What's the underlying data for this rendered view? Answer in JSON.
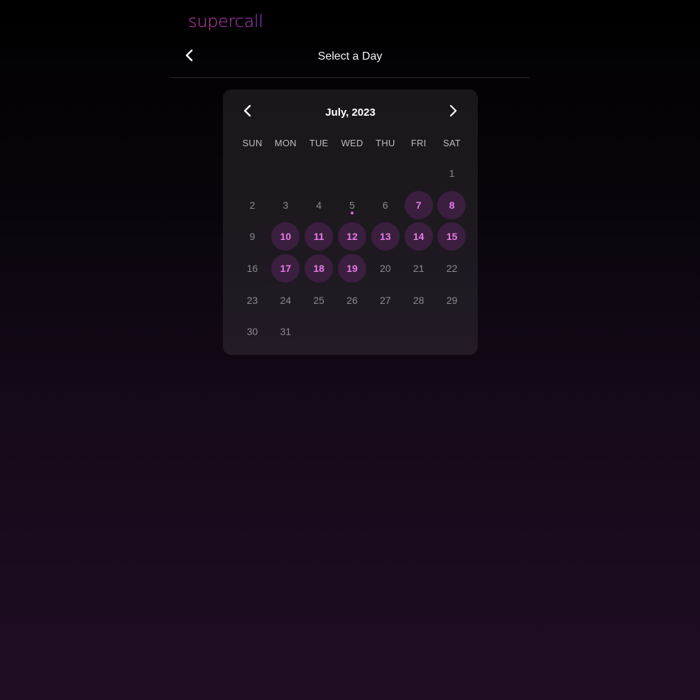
{
  "brand": {
    "logo_text": "supercall",
    "accent": "#c03ec7"
  },
  "header": {
    "title": "Select a Day",
    "back_icon": "chevron-left-icon"
  },
  "calendar": {
    "month_label": "July, 2023",
    "prev_icon": "chevron-left-icon",
    "next_icon": "chevron-right-icon",
    "weekdays": [
      "SUN",
      "MON",
      "TUE",
      "WED",
      "THU",
      "FRI",
      "SAT"
    ],
    "first_weekday_index": 6,
    "days_in_month": 31,
    "today": 5,
    "available_days": [
      7,
      8,
      10,
      11,
      12,
      13,
      14,
      15,
      17,
      18,
      19
    ],
    "available_color": "#e47ce6",
    "available_bg": "#3a1f3e"
  }
}
